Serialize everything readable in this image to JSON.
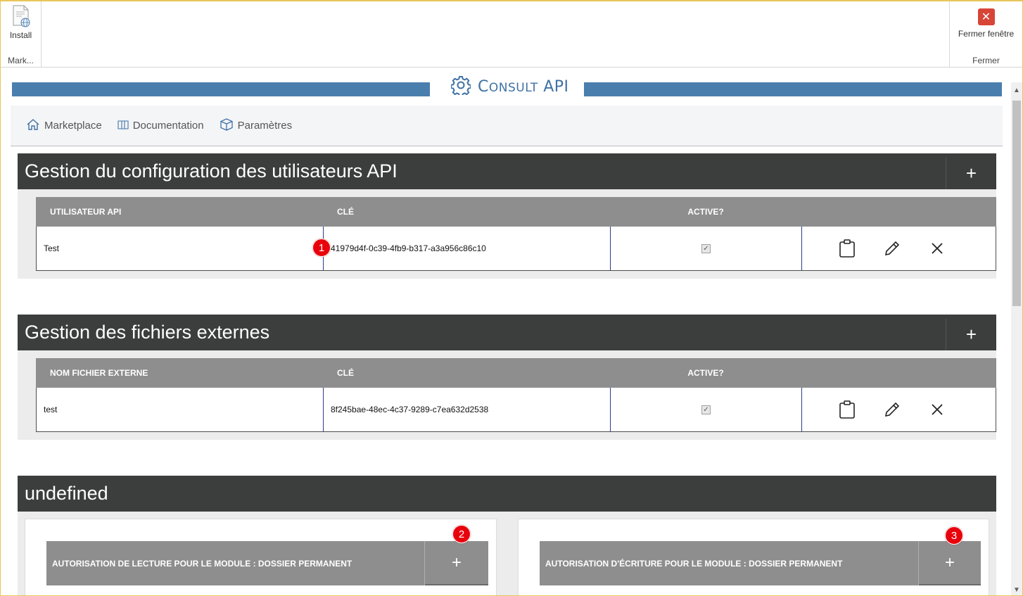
{
  "ribbon": {
    "install_label": "Install",
    "left_group_label": "Mark...",
    "close_label": "Fermer fenêtre",
    "right_group_label": "Fermer"
  },
  "header": {
    "title_first": "C",
    "title_small": "ONSULT",
    "title_last": " API"
  },
  "nav": {
    "items": [
      {
        "label": "Marketplace",
        "icon": "home-icon"
      },
      {
        "label": "Documentation",
        "icon": "book-icon"
      },
      {
        "label": "Paramètres",
        "icon": "box-icon"
      }
    ]
  },
  "sections": [
    {
      "title": "Gestion du configuration des utilisateurs API",
      "plus": "+",
      "columns": [
        "UTILISATEUR API",
        "CLÉ",
        "ACTIVE?"
      ],
      "rows": [
        {
          "name": "Test",
          "key": "41979d4f-0c39-4fb9-b317-a3a956c86c10",
          "active": true
        }
      ]
    },
    {
      "title": "Gestion des fichiers externes",
      "plus": "+",
      "columns": [
        "NOM FICHIER EXTERNE",
        "CLÉ",
        "ACTIVE?"
      ],
      "rows": [
        {
          "name": "test",
          "key": "8f245bae-48ec-4c37-9289-c7ea632d2538",
          "active": true
        }
      ]
    },
    {
      "title": "undefined"
    }
  ],
  "panels": [
    {
      "label": "AUTORISATION DE LECTURE POUR LE MODULE : DOSSIER PERMANENT",
      "plus": "+"
    },
    {
      "label": "AUTORISATION D'ÉCRITURE POUR LE MODULE : DOSSIER PERMANENT",
      "plus": "+"
    }
  ],
  "badges": [
    "1",
    "2",
    "3"
  ],
  "colors": {
    "accent": "#4a7ead",
    "section_header": "#3b3e3c",
    "grid_header": "#8e8e8e",
    "badge": "#e8000c",
    "close": "#d74537"
  }
}
